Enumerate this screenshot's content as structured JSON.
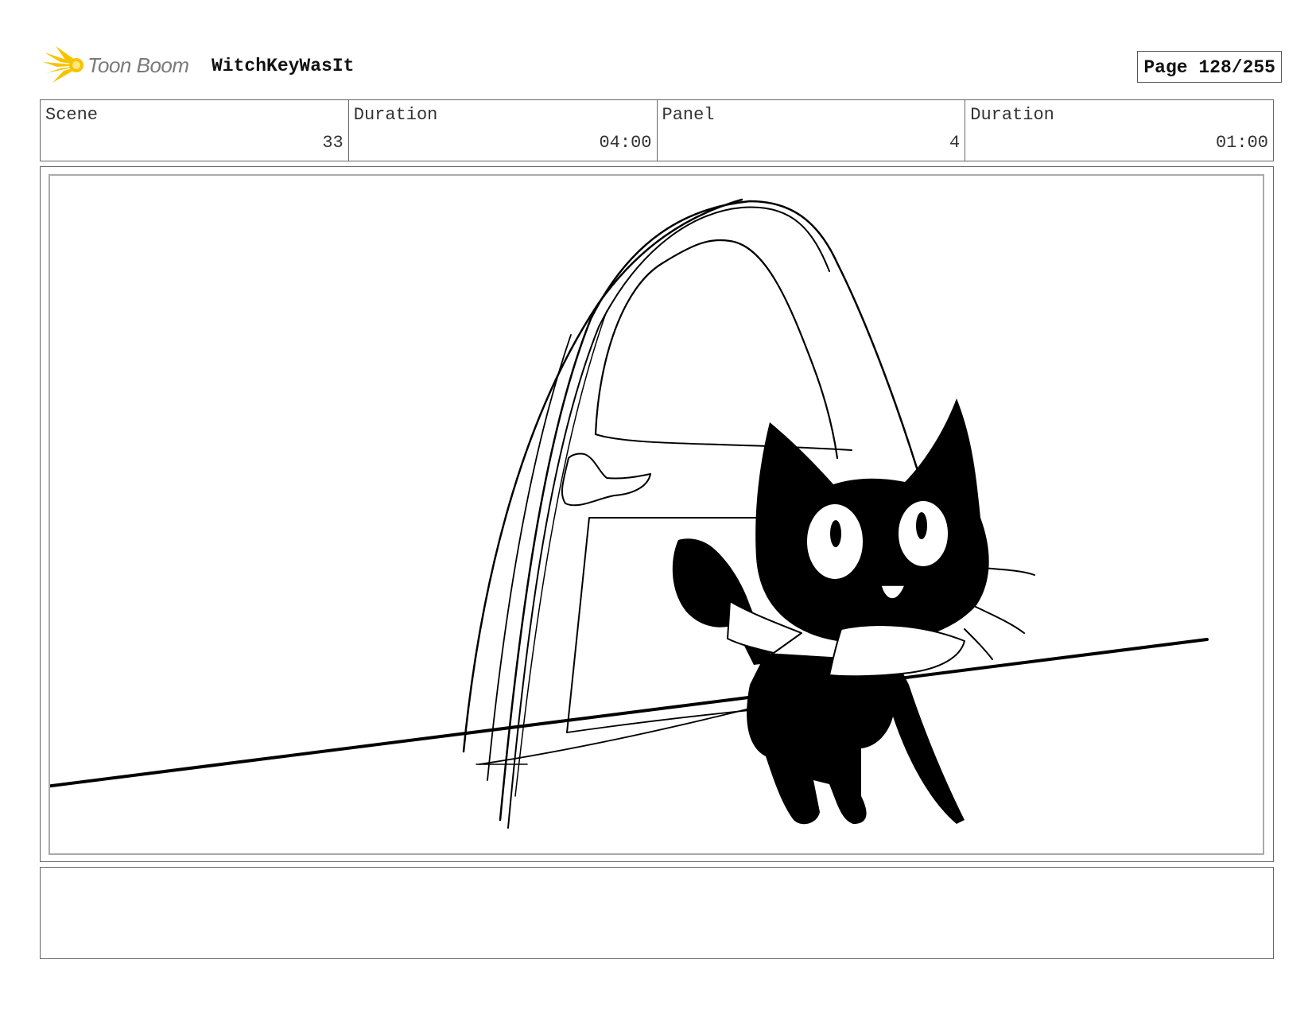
{
  "header": {
    "brand": "Toon Boom",
    "project_name": "WitchKeyWasIt",
    "page_label": "Page 128/255",
    "logo_icon": "toon-boom-star-logo",
    "logo_color": "#f5c400"
  },
  "info": {
    "scene_label": "Scene",
    "scene_value": "33",
    "scene_duration_label": "Duration",
    "scene_duration_value": "04:00",
    "panel_label": "Panel",
    "panel_value": "4",
    "panel_duration_label": "Duration",
    "panel_duration_value": "01:00"
  },
  "panel": {
    "drawing": "black-cat-walking-past-arched-doorway-sketch"
  },
  "notes": {
    "text": ""
  }
}
